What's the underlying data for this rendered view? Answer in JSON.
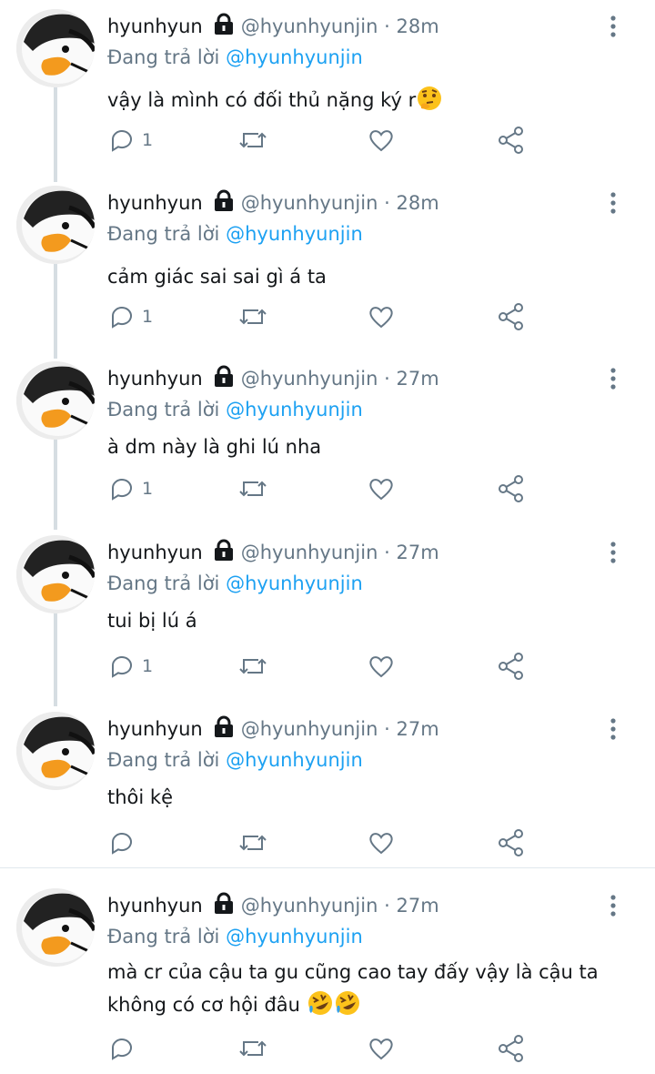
{
  "colors": {
    "accent": "#1da1f2",
    "text": "#14171a",
    "muted": "#657786",
    "thread_line": "#d6dde2"
  },
  "tweets": [
    {
      "display_name": "hyunhyun",
      "handle": "@hyunhyunjin",
      "separator": "·",
      "time": "28m",
      "reply_prefix": "Đang trả lời",
      "reply_to": "@hyunhyunjin",
      "text": "vậy là mình có đối thủ nặng ký r",
      "emoji": "thinking-face",
      "reply_count": "1"
    },
    {
      "display_name": "hyunhyun",
      "handle": "@hyunhyunjin",
      "separator": "·",
      "time": "28m",
      "reply_prefix": "Đang trả lời",
      "reply_to": "@hyunhyunjin",
      "text": "cảm giác sai sai gì á ta",
      "reply_count": "1"
    },
    {
      "display_name": "hyunhyun",
      "handle": "@hyunhyunjin",
      "separator": "·",
      "time": "27m",
      "reply_prefix": "Đang trả lời",
      "reply_to": "@hyunhyunjin",
      "text": "à dm này là ghi lú nha",
      "reply_count": "1"
    },
    {
      "display_name": "hyunhyun",
      "handle": "@hyunhyunjin",
      "separator": "·",
      "time": "27m",
      "reply_prefix": "Đang trả lời",
      "reply_to": "@hyunhyunjin",
      "text": "tui bị lú á",
      "reply_count": "1"
    },
    {
      "display_name": "hyunhyun",
      "handle": "@hyunhyunjin",
      "separator": "·",
      "time": "27m",
      "reply_prefix": "Đang trả lời",
      "reply_to": "@hyunhyunjin",
      "text": "thôi kệ",
      "reply_count": ""
    },
    {
      "display_name": "hyunhyun",
      "handle": "@hyunhyunjin",
      "separator": "·",
      "time": "27m",
      "reply_prefix": "Đang trả lời",
      "reply_to": "@hyunhyunjin",
      "text": "mà cr của cậu ta gu cũng cao tay đấy vậy là cậu ta không có cơ hội đâu",
      "emoji": "rolling-on-floor-laughing",
      "reply_count": ""
    }
  ]
}
